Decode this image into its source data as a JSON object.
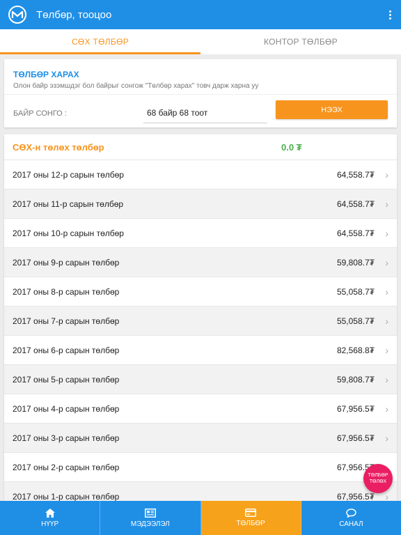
{
  "appbar": {
    "title": "Төлбөр, тооцоо"
  },
  "tabs": [
    {
      "label": "СӨХ ТӨЛБӨР",
      "active": true
    },
    {
      "label": "КОНТОР ТӨЛБӨР",
      "active": false
    }
  ],
  "view_payment": {
    "title": "ТӨЛБӨР ХАРАХ",
    "description": "Олон байр эзэмшдэг бол байрыг сонгож \"Төлбөр харах\" товч дарж харна уу",
    "select_label": "БАЙР СОНГО :",
    "selected_value": "68 байр 68 тоот",
    "open_button": "НЭЭХ"
  },
  "payments": {
    "title": "СӨХ-н төлөх төлбөр",
    "total": "0.0 ₮",
    "rows": [
      {
        "label": "2017 оны 12-р сарын төлбөр",
        "amount": "64,558.7₮"
      },
      {
        "label": "2017 оны 11-р сарын төлбөр",
        "amount": "64,558.7₮"
      },
      {
        "label": "2017 оны 10-р сарын төлбөр",
        "amount": "64,558.7₮"
      },
      {
        "label": "2017 оны 9-р сарын төлбөр",
        "amount": "59,808.7₮"
      },
      {
        "label": "2017 оны 8-р сарын төлбөр",
        "amount": "55,058.7₮"
      },
      {
        "label": "2017 оны 7-р сарын төлбөр",
        "amount": "55,058.7₮"
      },
      {
        "label": "2017 оны 6-р сарын төлбөр",
        "amount": "82,568.8₮"
      },
      {
        "label": "2017 оны 5-р сарын төлбөр",
        "amount": "59,808.7₮"
      },
      {
        "label": "2017 оны 4-р сарын төлбөр",
        "amount": "67,956.5₮"
      },
      {
        "label": "2017 оны 3-р сарын төлбөр",
        "amount": "67,956.5₮"
      },
      {
        "label": "2017 оны 2-р сарын төлбөр",
        "amount": "67,956.5₮"
      },
      {
        "label": "2017 оны 1-р сарын төлбөр",
        "amount": "67,956.5₮"
      }
    ]
  },
  "fab": {
    "line1": "ТӨЛБӨР",
    "line2": "ТӨЛӨХ"
  },
  "bottom_nav": [
    {
      "label": "НҮҮР",
      "icon": "home-icon",
      "active": false
    },
    {
      "label": "МЭДЭЭЛЭЛ",
      "icon": "news-icon",
      "active": false
    },
    {
      "label": "ТӨЛБӨР",
      "icon": "credit-card-icon",
      "active": true
    },
    {
      "label": "САНАЛ",
      "icon": "chat-icon",
      "active": false
    }
  ],
  "colors": {
    "primary": "#1f8fe6",
    "accent": "#f7941d",
    "total": "#4caf50",
    "fab": "#e91e63"
  }
}
